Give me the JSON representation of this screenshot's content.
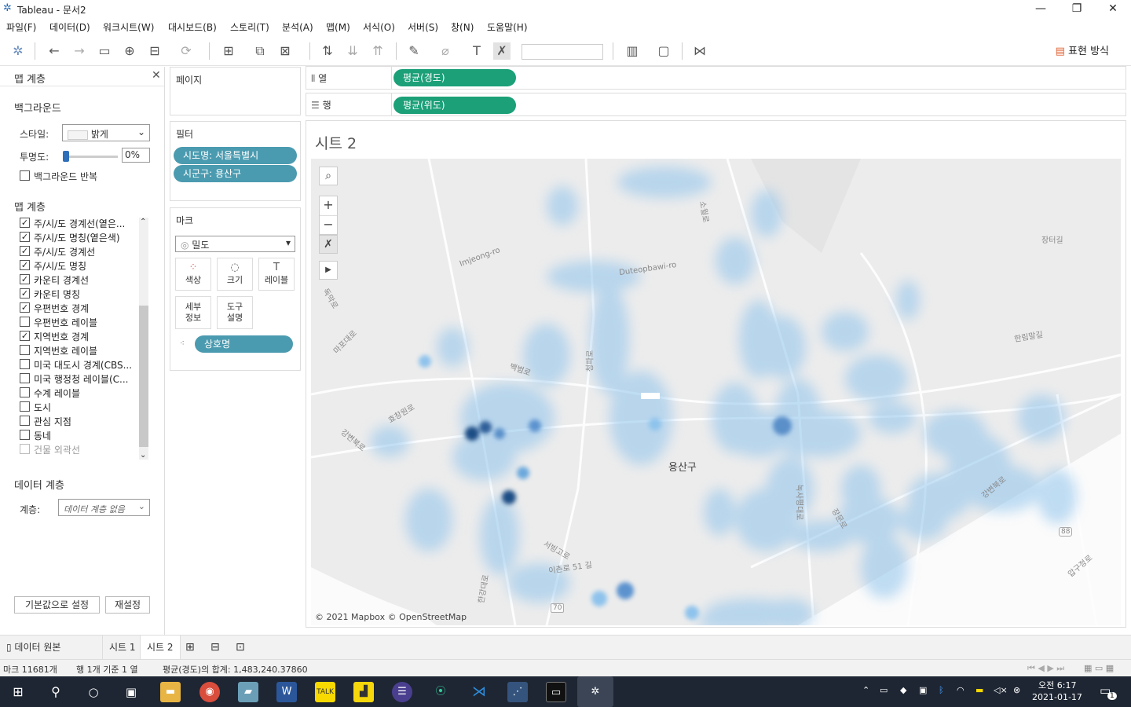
{
  "window": {
    "title": "Tableau - 문서2"
  },
  "menu": [
    "파일(F)",
    "데이터(D)",
    "워크시트(W)",
    "대시보드(B)",
    "스토리(T)",
    "분석(A)",
    "맵(M)",
    "서식(O)",
    "서버(S)",
    "창(N)",
    "도움말(H)"
  ],
  "toolbar": {
    "show_me": "표현 방식"
  },
  "map_layers_panel": {
    "title": "맵 계층",
    "background_heading": "백그라운드",
    "style_label": "스타일:",
    "style_value": "밝게",
    "opacity_label": "투명도:",
    "opacity_value": "0%",
    "repeat_bg": "백그라운드 반복",
    "layers_heading": "맵 계층",
    "layers": [
      {
        "label": "주/시/도 경계선(옅은...",
        "checked": true
      },
      {
        "label": "주/시/도 명칭(옅은색)",
        "checked": true
      },
      {
        "label": "주/시/도 경계선",
        "checked": true
      },
      {
        "label": "주/시/도 명칭",
        "checked": true
      },
      {
        "label": "카운티 경계선",
        "checked": true
      },
      {
        "label": "카운티 명칭",
        "checked": true
      },
      {
        "label": "우편번호 경계",
        "checked": true
      },
      {
        "label": "우편번호 레이블",
        "checked": false
      },
      {
        "label": "지역번호 경계",
        "checked": true
      },
      {
        "label": "지역번호 레이블",
        "checked": false
      },
      {
        "label": "미국 대도시 경계(CBS...",
        "checked": false
      },
      {
        "label": "미국 행정청 레이블(C...",
        "checked": false
      },
      {
        "label": "수계 레이블",
        "checked": false
      },
      {
        "label": "도시",
        "checked": false
      },
      {
        "label": "관심 지점",
        "checked": false
      },
      {
        "label": "동네",
        "checked": false
      },
      {
        "label": "건물 외곽선",
        "checked": false
      }
    ],
    "data_layer_heading": "데이터 계층",
    "layer_label": "계층:",
    "layer_placeholder": "데이터 계층 없음",
    "default_button": "기본값으로 설정",
    "reset_button": "재설정"
  },
  "pages_card": {
    "title": "페이지"
  },
  "filters_card": {
    "title": "필터",
    "filters": [
      "시도명: 서울특별시",
      "시군구: 용산구"
    ]
  },
  "marks_card": {
    "title": "마크",
    "mark_type": "밀도",
    "buttons": [
      "색상",
      "크기",
      "레이블",
      "세부\n정보",
      "도구\n설명"
    ],
    "field": "상호명"
  },
  "columns_shelf": {
    "label": "열",
    "pill": "평균(경도)"
  },
  "rows_shelf": {
    "label": "행",
    "pill": "평균(위도)"
  },
  "sheet": {
    "title": "시트 2"
  },
  "map": {
    "district_label": "용산구",
    "attribution": "© 2021 Mapbox © OpenStreetMap",
    "road_labels": [
      "Imjeong-ro",
      "Duteopbawi-ro",
      "백범로",
      "청파로",
      "효창원로",
      "강변북로",
      "서빙고로",
      "이촌로 51 길",
      "한강대로",
      "녹사평대로",
      "장터길",
      "한림말길",
      "강변북로",
      "압구정로",
      "장문로",
      "독막로",
      "마포대로",
      "소월로",
      "88",
      "70"
    ]
  },
  "tabs": {
    "data_source": "데이터 원본",
    "sheets": [
      "시트 1",
      "시트 2"
    ],
    "active": "시트 2"
  },
  "status": {
    "marks": "마크 11681개",
    "rows": "행 1개 기준 1 열",
    "sum": "평균(경도)의 합계: 1,483,240.37860"
  },
  "taskbar": {
    "time": "오전 6:17",
    "date": "2021-01-17",
    "notif_count": "1"
  }
}
